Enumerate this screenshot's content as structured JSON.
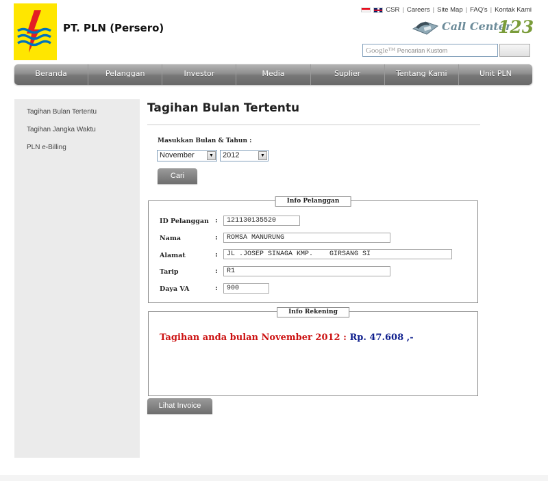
{
  "header": {
    "company_name": "PT. PLN (Persero)",
    "top_links": [
      "CSR",
      "Careers",
      "Site Map",
      "FAQ's",
      "Kontak Kami"
    ],
    "call_center_text": "Call Center",
    "call_center_number": "123",
    "search_brand": "Google™",
    "search_placeholder": "Pencarian Kustom"
  },
  "nav": {
    "items": [
      "Beranda",
      "Pelanggan",
      "Investor",
      "Media",
      "Suplier",
      "Tentang Kami",
      "Unit PLN"
    ]
  },
  "sidebar": {
    "items": [
      "Tagihan Bulan Tertentu",
      "Tagihan Jangka Waktu",
      "PLN e-Billing"
    ]
  },
  "main": {
    "title": "Tagihan Bulan Tertentu",
    "month_year_label": "Masukkan Bulan & Tahun :",
    "selected_month": "November",
    "selected_year": "2012",
    "search_button": "Cari",
    "invoice_button": "Lihat Invoice"
  },
  "info_pelanggan": {
    "legend": "Info Pelanggan",
    "colon": ":",
    "fields": [
      {
        "label": "ID Pelanggan",
        "value": "121130135520"
      },
      {
        "label": "Nama",
        "value": "ROMSA MANURUNG"
      },
      {
        "label": "Alamat",
        "value": "JL .JOSEP SINAGA KMP.    GIRSANG SI"
      },
      {
        "label": "Tarip",
        "value": "R1"
      },
      {
        "label": "Daya VA",
        "value": "900"
      }
    ]
  },
  "info_rekening": {
    "legend": "Info Rekening",
    "bill_text": "Tagihan anda bulan November 2012 : ",
    "bill_amount": "Rp. 47.608 ,-"
  },
  "colors": {
    "logo_yellow": "#ffe600",
    "bill_red": "#cc1111",
    "bill_blue": "#10208e"
  }
}
